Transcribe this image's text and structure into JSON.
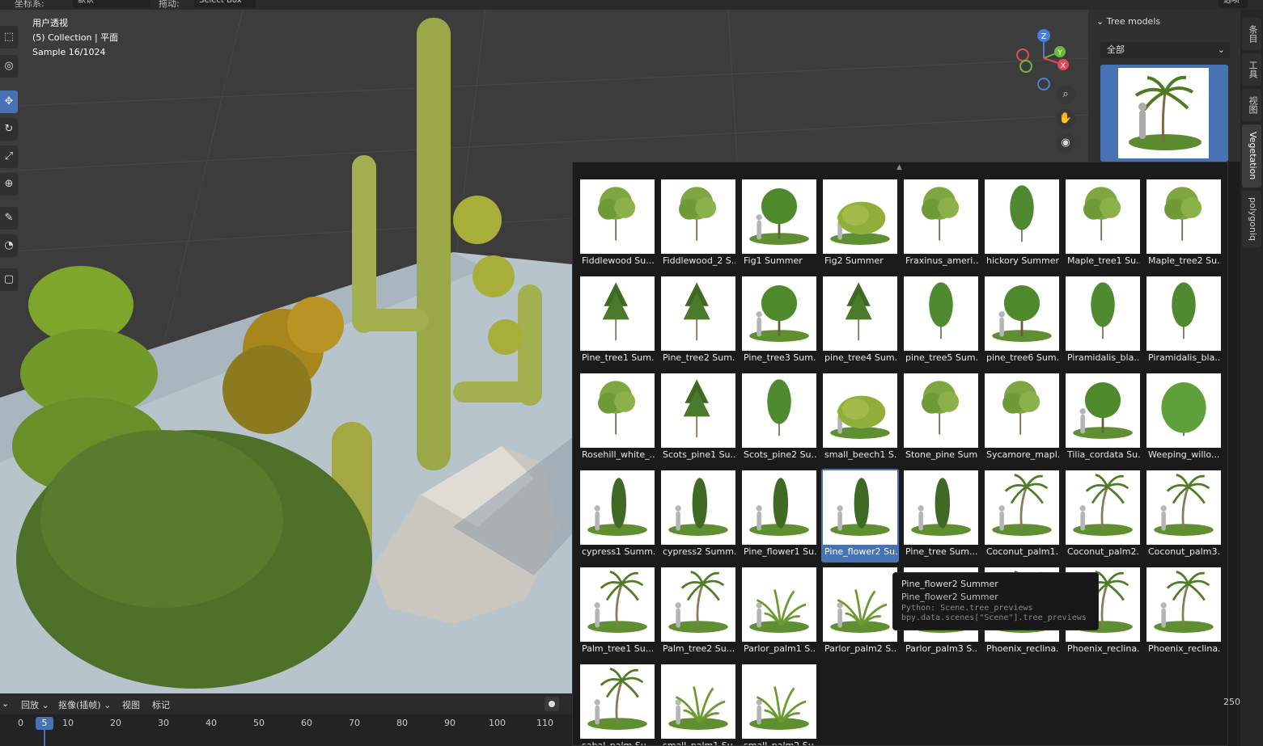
{
  "header": {
    "coord_label": "坐标系:",
    "coord_value": "默认",
    "drag_label": "拖动:",
    "drag_value": "Select Box",
    "options_label": "选项"
  },
  "viewport": {
    "view_name": "用户透视",
    "collection": "(5) Collection | 平面",
    "sample": "Sample 16/1024",
    "gizmo_axes": [
      "Z",
      "Y",
      "X"
    ]
  },
  "sidebar": {
    "panel_title": "Tree models",
    "category_value": "全部",
    "tabs": [
      "条目",
      "工具",
      "视图",
      "Vegetation",
      "polygoniq"
    ]
  },
  "tooltip": {
    "title": "Pine_flower2 Summer",
    "description": "Pine_flower2 Summer",
    "python_line1": "Python: Scene.tree_previews",
    "python_line2": "bpy.data.scenes[\"Scene\"].tree_previews"
  },
  "grid": {
    "items": [
      {
        "label": "Fiddlewood Su...",
        "shape": "broad"
      },
      {
        "label": "Fiddlewood_2 S...",
        "shape": "broad"
      },
      {
        "label": "Fig1 Summer",
        "shape": "round"
      },
      {
        "label": "Fig2 Summer",
        "shape": "bush"
      },
      {
        "label": "Fraxinus_ameri...",
        "shape": "broad"
      },
      {
        "label": "hickory Summer",
        "shape": "tall"
      },
      {
        "label": "Maple_tree1 Su...",
        "shape": "broad"
      },
      {
        "label": "Maple_tree2 Su...",
        "shape": "broad"
      },
      {
        "label": "Pine_tree1 Sum...",
        "shape": "pine"
      },
      {
        "label": "Pine_tree2 Sum...",
        "shape": "pine"
      },
      {
        "label": "Pine_tree3 Sum...",
        "shape": "round"
      },
      {
        "label": "pine_tree4 Sum...",
        "shape": "pine"
      },
      {
        "label": "pine_tree5 Sum...",
        "shape": "tall"
      },
      {
        "label": "pine_tree6 Sum...",
        "shape": "round"
      },
      {
        "label": "Piramidalis_bla...",
        "shape": "tall"
      },
      {
        "label": "Piramidalis_bla...",
        "shape": "tall"
      },
      {
        "label": "Rosehill_white_...",
        "shape": "broad"
      },
      {
        "label": "Scots_pine1 Su...",
        "shape": "pine"
      },
      {
        "label": "Scots_pine2 Su...",
        "shape": "tall"
      },
      {
        "label": "small_beech1 S...",
        "shape": "bush"
      },
      {
        "label": "Stone_pine Sum...",
        "shape": "broad"
      },
      {
        "label": "Sycamore_mapl...",
        "shape": "broad"
      },
      {
        "label": "Tilia_cordata Su...",
        "shape": "round"
      },
      {
        "label": "Weeping_willo...",
        "shape": "willow"
      },
      {
        "label": "cypress1 Summ...",
        "shape": "cypress"
      },
      {
        "label": "cypress2 Summ...",
        "shape": "cypress"
      },
      {
        "label": "Pine_flower1 Su...",
        "shape": "cypress"
      },
      {
        "label": "Pine_flower2 Su...",
        "shape": "cypress"
      },
      {
        "label": "Pine_tree Sum...",
        "shape": "cypress"
      },
      {
        "label": "Coconut_palm1...",
        "shape": "palm"
      },
      {
        "label": "Coconut_palm2...",
        "shape": "palm"
      },
      {
        "label": "Coconut_palm3...",
        "shape": "palm"
      },
      {
        "label": "Palm_tree1 Su...",
        "shape": "palm"
      },
      {
        "label": "Palm_tree2 Su...",
        "shape": "palm"
      },
      {
        "label": "Parlor_palm1 S...",
        "shape": "fern"
      },
      {
        "label": "Parlor_palm2 S...",
        "shape": "fern"
      },
      {
        "label": "Parlor_palm3 S...",
        "shape": "fern"
      },
      {
        "label": "Phoenix_reclina...",
        "shape": "palm"
      },
      {
        "label": "Phoenix_reclina...",
        "shape": "palm"
      },
      {
        "label": "Phoenix_reclina...",
        "shape": "palm"
      },
      {
        "label": "sabal_palm Su...",
        "shape": "palm"
      },
      {
        "label": "small_palm1 Su...",
        "shape": "fern"
      },
      {
        "label": "small_palm2 Su...",
        "shape": "fern"
      }
    ],
    "selected_index": 27
  },
  "timeline": {
    "menus": [
      "回放",
      "抠像(插帧)",
      "视图",
      "标记"
    ],
    "ticks": [
      "0",
      "10",
      "20",
      "30",
      "40",
      "50",
      "60",
      "70",
      "80",
      "90",
      "100",
      "110"
    ],
    "current_frame": "5",
    "end_frame": "250"
  },
  "colors": {
    "accent": "#4772b3",
    "panel": "#303030",
    "background": "#1d1d1d"
  }
}
